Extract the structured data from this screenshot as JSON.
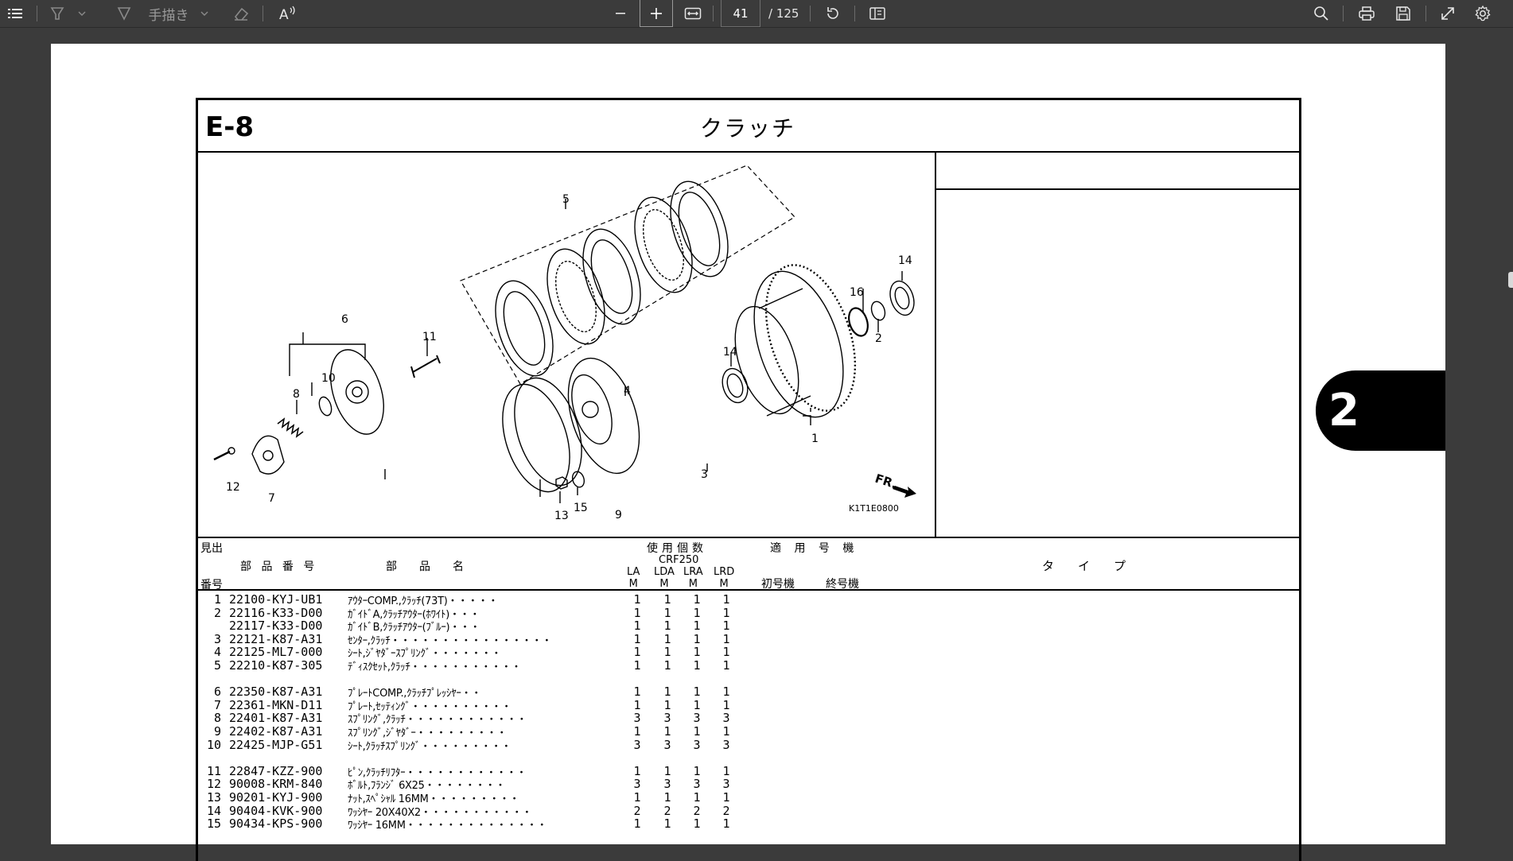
{
  "toolbar": {
    "draw_label": "手描き",
    "page_current": "41",
    "page_total": "/ 125"
  },
  "side_tab": {
    "label": "2"
  },
  "section": {
    "code": "E-8",
    "title": "クラッチ"
  },
  "diagram": {
    "callouts": [
      "1",
      "2",
      "3",
      "4",
      "5",
      "6",
      "7",
      "8",
      "9",
      "10",
      "11",
      "12",
      "13",
      "14",
      "14",
      "15",
      "16"
    ],
    "front_mark": "FR.",
    "figure_code": "K1T1E0800"
  },
  "table_header": {
    "ref_top": "見出",
    "ref_bottom": "番号",
    "part_no": "部 品 番 号",
    "part_name": "部　　品　　名",
    "qty": "使用個数",
    "model": "CRF250",
    "col_la": "LA\nM",
    "col_lda": "LDA\nM",
    "col_lra": "LRA\nM",
    "col_lrd": "LRD\nM",
    "serial": "適 用 号 機",
    "serial_first": "初号機",
    "serial_last": "終号機",
    "type": "タ　　イ　　プ"
  },
  "parts": [
    {
      "ref": "1",
      "pno": "22100-KYJ-UB1",
      "desc": "ｱｳﾀｰCOMP.,ｸﾗｯﾁ(73T)・・・・・",
      "q": [
        "1",
        "1",
        "1",
        "1"
      ]
    },
    {
      "ref": "2",
      "pno": "22116-K33-D00",
      "desc": "ｶﾞｲﾄﾞA,ｸﾗｯﾁｱｳﾀｰ(ﾎﾜｲﾄ)・・・",
      "q": [
        "1",
        "1",
        "1",
        "1"
      ]
    },
    {
      "ref": "",
      "pno": "22117-K33-D00",
      "desc": "ｶﾞｲﾄﾞB,ｸﾗｯﾁｱｳﾀｰ(ﾌﾞﾙｰ)・・・",
      "q": [
        "1",
        "1",
        "1",
        "1"
      ]
    },
    {
      "ref": "3",
      "pno": "22121-K87-A31",
      "desc": "ｾﾝﾀｰ,ｸﾗｯﾁ・・・・・・・・・・・・・・・・",
      "q": [
        "1",
        "1",
        "1",
        "1"
      ]
    },
    {
      "ref": "4",
      "pno": "22125-ML7-000",
      "desc": "ｼｰﾄ,ｼﾞﾔﾀﾞｰｽﾌﾟﾘﾝｸﾞ・・・・・・・",
      "q": [
        "1",
        "1",
        "1",
        "1"
      ]
    },
    {
      "ref": "5",
      "pno": "22210-K87-305",
      "desc": "ﾃﾞｨｽｸｾｯﾄ,ｸﾗｯﾁ・・・・・・・・・・・",
      "q": [
        "1",
        "1",
        "1",
        "1"
      ]
    },
    {
      "ref": "6",
      "pno": "22350-K87-A31",
      "desc": "ﾌﾟﾚｰﾄCOMP.,ｸﾗｯﾁﾌﾟﾚｯｼﾔｰ・・",
      "q": [
        "1",
        "1",
        "1",
        "1"
      ]
    },
    {
      "ref": "7",
      "pno": "22361-MKN-D11",
      "desc": "ﾌﾟﾚｰﾄ,ｾｯﾃｨﾝｸﾞ・・・・・・・・・・",
      "q": [
        "1",
        "1",
        "1",
        "1"
      ]
    },
    {
      "ref": "8",
      "pno": "22401-K87-A31",
      "desc": "ｽﾌﾟﾘﾝｸﾞ,ｸﾗｯﾁ・・・・・・・・・・・・",
      "q": [
        "3",
        "3",
        "3",
        "3"
      ]
    },
    {
      "ref": "9",
      "pno": "22402-K87-A31",
      "desc": "ｽﾌﾟﾘﾝｸﾞ,ｼﾞﾔﾀﾞｰ・・・・・・・・・",
      "q": [
        "1",
        "1",
        "1",
        "1"
      ]
    },
    {
      "ref": "10",
      "pno": "22425-MJP-G51",
      "desc": "ｼｰﾄ,ｸﾗｯﾁｽﾌﾟﾘﾝｸﾞ・・・・・・・・・",
      "q": [
        "3",
        "3",
        "3",
        "3"
      ]
    },
    {
      "ref": "11",
      "pno": "22847-KZZ-900",
      "desc": "ﾋﾟﾝ,ｸﾗｯﾁﾘﾌﾀｰ・・・・・・・・・・・・",
      "q": [
        "1",
        "1",
        "1",
        "1"
      ]
    },
    {
      "ref": "12",
      "pno": "90008-KRM-840",
      "desc": "ﾎﾞﾙﾄ,ﾌﾗﾝｼﾞ 6X25・・・・・・・・",
      "q": [
        "3",
        "3",
        "3",
        "3"
      ]
    },
    {
      "ref": "13",
      "pno": "90201-KYJ-900",
      "desc": "ﾅｯﾄ,ｽﾍﾟｼｬﾙ 16MM・・・・・・・・・",
      "q": [
        "1",
        "1",
        "1",
        "1"
      ]
    },
    {
      "ref": "14",
      "pno": "90404-KVK-900",
      "desc": "ﾜｯｼﾔｰ 20X40X2・・・・・・・・・・・",
      "q": [
        "2",
        "2",
        "2",
        "2"
      ]
    },
    {
      "ref": "15",
      "pno": "90434-KPS-900",
      "desc": "ﾜｯｼﾔｰ 16MM・・・・・・・・・・・・・・",
      "q": [
        "1",
        "1",
        "1",
        "1"
      ]
    }
  ]
}
